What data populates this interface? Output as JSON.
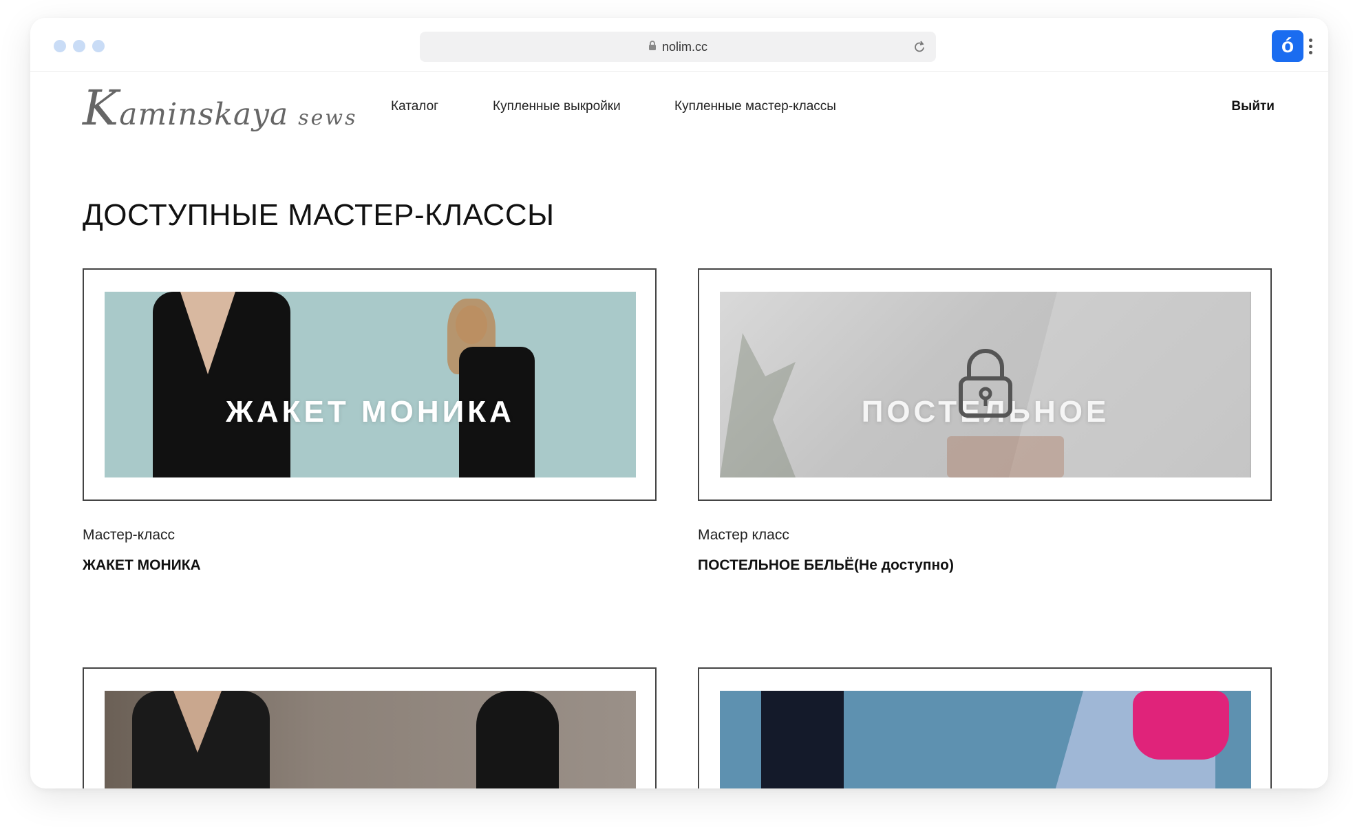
{
  "browser": {
    "url": "nolim.cc",
    "extension_letter": "ó"
  },
  "nav": {
    "logo_main": "aminskaya",
    "logo_initial": "K",
    "logo_suffix": "sews",
    "links": [
      "Каталог",
      "Купленные выкройки",
      "Купленные мастер-классы"
    ],
    "logout": "Выйти"
  },
  "page": {
    "heading": "ДОСТУПНЫЕ МАСТЕР-КЛАССЫ"
  },
  "cards": [
    {
      "banner": "ЖАКЕТ МОНИКА",
      "label": "Мастер-класс",
      "title": "ЖАКЕТ МОНИКА",
      "locked": false
    },
    {
      "banner": "ПОСТЕЛЬНОЕ",
      "label": "Мастер класс",
      "title": "ПОСТЕЛЬНОЕ БЕЛЬЁ(Не доступно)",
      "locked": true
    },
    {
      "banner": "",
      "label": "",
      "title": ""
    },
    {
      "banner": "",
      "label": "",
      "title": ""
    }
  ],
  "colors": {
    "accent": "#1a6cf0",
    "traffic": "#c9dcf6"
  }
}
